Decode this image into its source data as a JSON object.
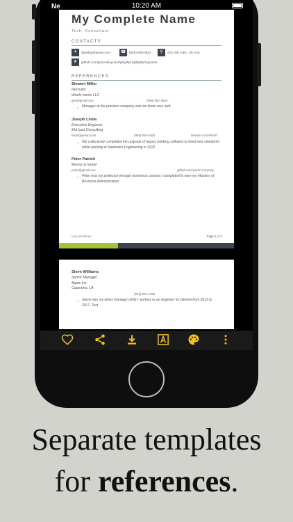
{
  "status": {
    "carrier": "Ne",
    "time": "10:20 AM"
  },
  "resume": {
    "name": "My Complete Name",
    "role": "Tech. Consultant",
    "contacts_heading": "CONTACTS",
    "contacts": {
      "email": "develop@woolv.com",
      "phone": "(848) 255-0822",
      "address": "#23, 5th main, 7th cros",
      "github": "github.com/generalmyuserhjkhjkhjk hjkhjkhjk/myname"
    },
    "references_heading": "REFERENCES",
    "references": [
      {
        "name": "Stewert Miller",
        "role": "Recruiter",
        "company": "Woolv works LLC",
        "email": "gen@gmail.com",
        "phone": "(856) 562-3656",
        "desc": "Manager at the previous company and we know very well."
      },
      {
        "name": "Joseph Linda",
        "role": "Executive Engineer",
        "company": "McLlyod Consulting",
        "email": "linda@yahoo.com",
        "phone": "(958) 565-6465",
        "link": "linkedin.com/sherth",
        "desc": "We collectively completed the upgrade of legacy banking software to meet new standards while working at Newmann Engineering in 2022."
      },
      {
        "name": "Peter Patrick",
        "role": "Mentor & trainer",
        "email": "peter@gmail.com",
        "link": "github.com/woolv-company",
        "desc": "Peter was my professor through numerous courses I completed to earn my Masters of Business Administration."
      }
    ],
    "footer_left": "resji.com/tinner",
    "footer_right": "Page 1 of 2",
    "page2_reference": {
      "name": "Steve Williams",
      "role": "Senior Manager",
      "company": "Apple Inc.",
      "location": "Cupertino, LA",
      "phone": "(937) 939-2166",
      "desc": "Steve was my direct manager while I worked as an engineer for Gemini from 2013 to 2017. Test"
    }
  },
  "toolbar": [
    "heart-icon",
    "share-icon",
    "download-icon",
    "font-icon",
    "palette-icon",
    "more-vert-icon"
  ],
  "colors": {
    "accent_yellow": "#f1c21b",
    "band_dark": "#3d4450",
    "band_green": "#a6c23c"
  },
  "caption": {
    "line1": "Separate templates",
    "line2_prefix": "for ",
    "line2_bold": "references",
    "line2_suffix": "."
  }
}
